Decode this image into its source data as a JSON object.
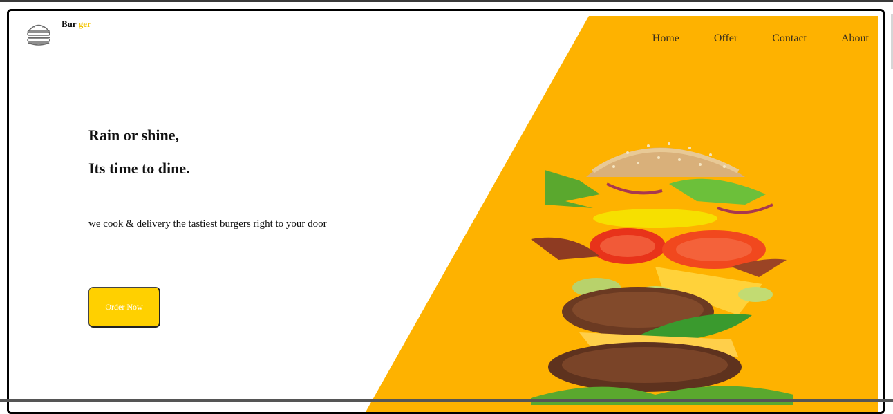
{
  "brand": {
    "part1": "Bur",
    "part2": "ger"
  },
  "nav": {
    "items": [
      "Home",
      "Offer",
      "Contact",
      "About"
    ]
  },
  "hero": {
    "line1": "Rain or shine,",
    "line2": "Its time to dine.",
    "tagline": "we cook & delivery the tastiest burgers right to your door",
    "cta_label": "Order Now"
  },
  "colors": {
    "panel": "#feb200",
    "button": "#ffd000",
    "brand_accent": "#f2c300"
  },
  "icons": {
    "logo": "burger-icon"
  }
}
